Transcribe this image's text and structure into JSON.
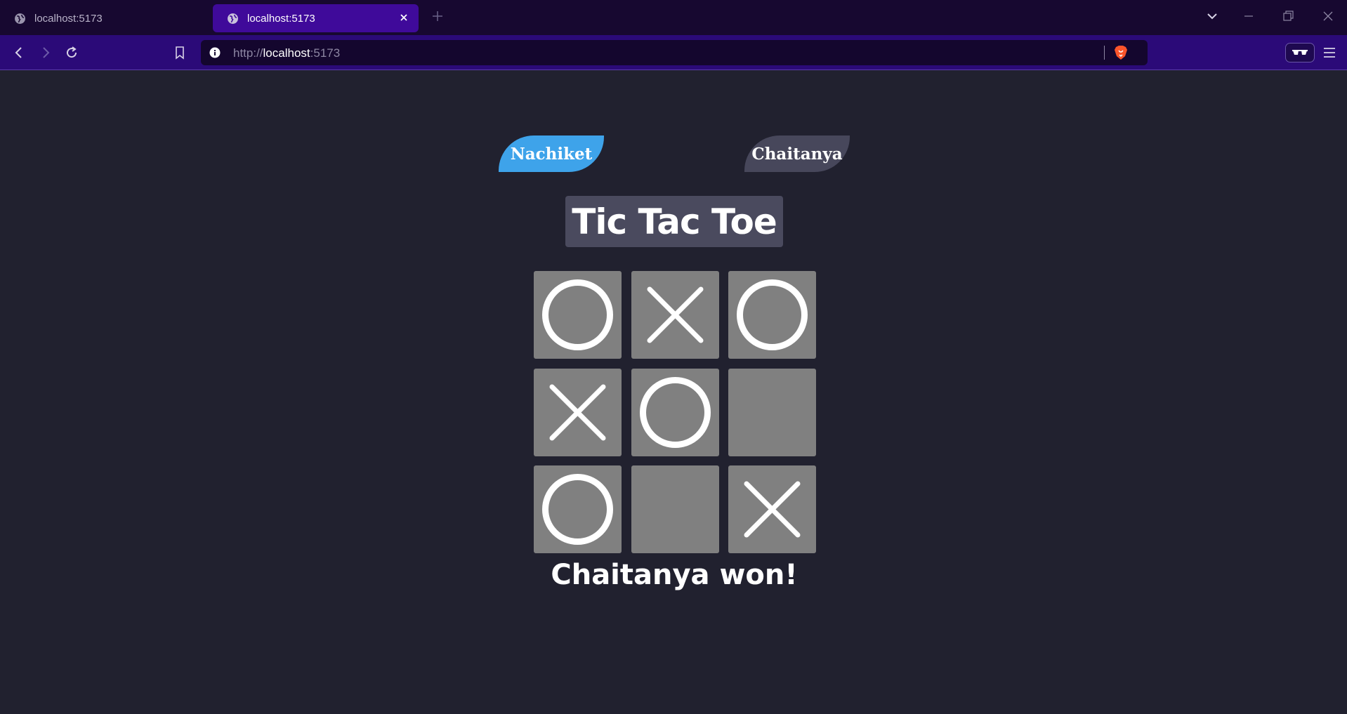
{
  "browser": {
    "tabs": [
      {
        "label": "localhost:5173",
        "active": false
      },
      {
        "label": "localhost:5173",
        "active": true
      }
    ],
    "url_prefix": "http://",
    "url_host": "localhost",
    "url_port": ":5173"
  },
  "game": {
    "players": [
      "Nachiket",
      "Chaitanya"
    ],
    "active_player": "Nachiket",
    "title": "Tic Tac Toe",
    "board": [
      "O",
      "X",
      "O",
      "X",
      "O",
      "",
      "O",
      "",
      "X"
    ],
    "status": "Chaitanya won!"
  },
  "colors": {
    "page_bg": "#21212f",
    "active_player": "#3ea3ea",
    "inactive_player": "#47475b",
    "cell": "#808080",
    "mark": "#ffffff"
  },
  "icons": [
    "globe-icon",
    "close-icon",
    "plus-icon",
    "chevron-down-icon",
    "minimize-icon",
    "restore-icon",
    "window-close-icon",
    "back-icon",
    "forward-icon",
    "reload-icon",
    "bookmark-icon",
    "info-icon",
    "brave-lion-icon",
    "sunglasses-icon",
    "menu-icon"
  ]
}
